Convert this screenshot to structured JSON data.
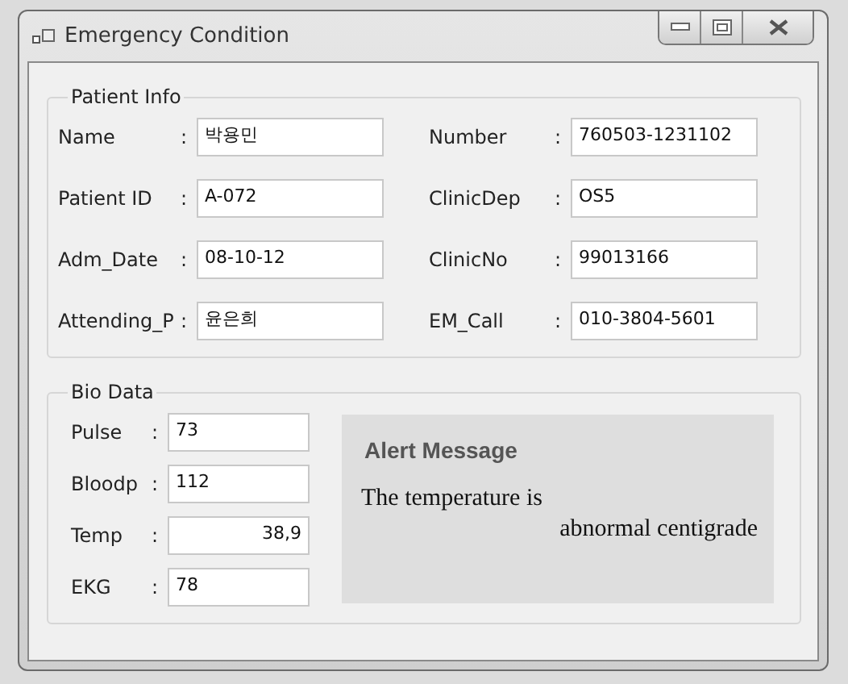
{
  "window": {
    "title": "Emergency Condition"
  },
  "patient_info": {
    "title": "Patient Info",
    "fields": [
      {
        "label": "Name",
        "separator": ":",
        "value": "박용민"
      },
      {
        "label": "Number",
        "separator": ":",
        "value": "760503-1231102"
      },
      {
        "label": "Patient ID",
        "separator": ":",
        "value": "A-072"
      },
      {
        "label": "ClinicDep",
        "separator": ":",
        "value": "OS5"
      },
      {
        "label": "Adm_Date",
        "separator": ":",
        "value": "08-10-12"
      },
      {
        "label": "ClinicNo",
        "separator": ":",
        "value": "99013166"
      },
      {
        "label": "Attending_P",
        "separator": ":",
        "value": "윤은희"
      },
      {
        "label": "EM_Call",
        "separator": ":",
        "value": "010-3804-5601"
      }
    ]
  },
  "bio_data": {
    "title": "Bio Data",
    "fields": [
      {
        "label": "Pulse",
        "separator": ":",
        "value": "73",
        "right_aligned": false
      },
      {
        "label": "Bloodp",
        "separator": ":",
        "value": "112",
        "right_aligned": false
      },
      {
        "label": "Temp",
        "separator": ":",
        "value": "38,9",
        "right_aligned": true
      },
      {
        "label": "EKG",
        "separator": ":",
        "value": "78",
        "right_aligned": false
      }
    ],
    "alert": {
      "title": "Alert Message",
      "lines": [
        "The temperature is",
        "abnormal centigrade"
      ]
    }
  }
}
